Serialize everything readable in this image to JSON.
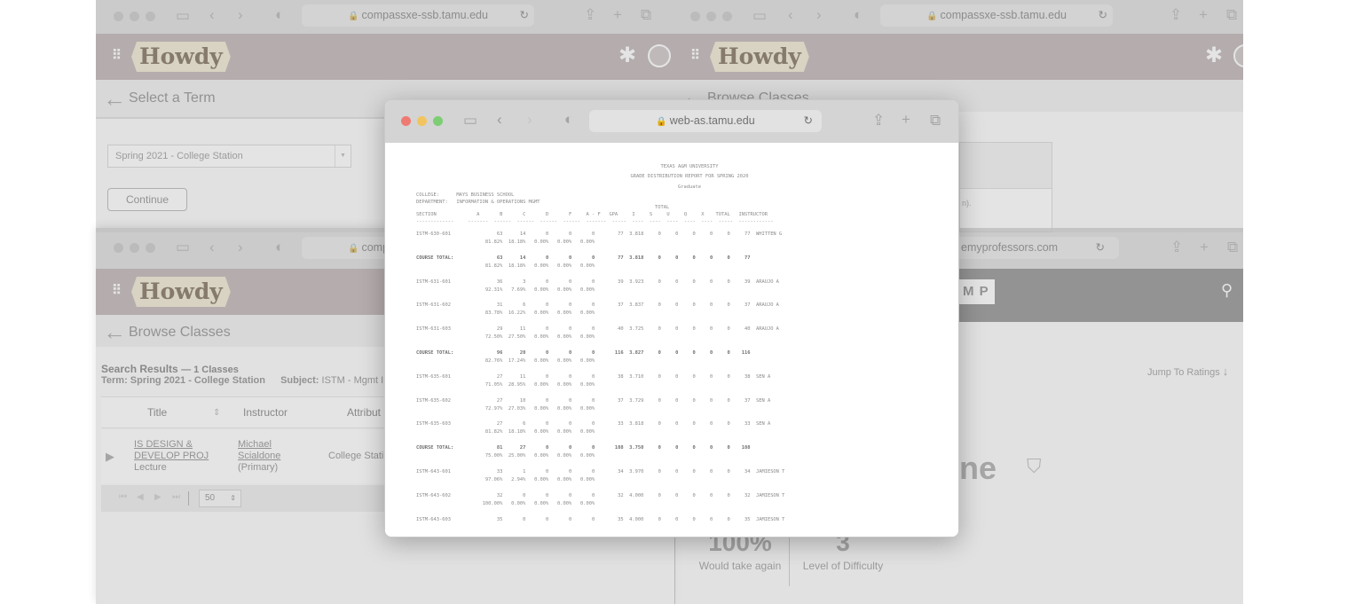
{
  "win_top_left": {
    "url": "compassxe-ssb.tamu.edu",
    "logo": "Howdy",
    "page_title": "Select a Term",
    "term_value": "Spring 2021 - College Station",
    "continue_label": "Continue"
  },
  "win_top_right": {
    "url": "compassxe-ssb.tamu.edu",
    "logo": "Howdy",
    "page_title": "Browse Classes",
    "snippet": "n)."
  },
  "win_browse": {
    "url": "comp",
    "logo": "Howdy",
    "page_title": "Browse Classes",
    "results_title": "Search Results",
    "results_count": "— 1 Classes",
    "term_line": "Term: Spring 2021 - College Station",
    "subject_label": "Subject:",
    "subject_value": "ISTM - Mgmt I",
    "columns": [
      "Title",
      "Instructor",
      "Attribut"
    ],
    "row": {
      "title_1": "IS DESIGN &",
      "title_2": "DEVELOP PROJ",
      "type": "Lecture",
      "instructor_1": "Michael",
      "instructor_2": "Scialdone",
      "instructor_role": "(Primary)",
      "attribute": "College Stati"
    },
    "page_size": "50"
  },
  "win_rmp": {
    "url": "emyprofessors.com",
    "logo": "M P",
    "jump_label": "Jump To Ratings",
    "name_fragment": "ne",
    "stat1_value": "100%",
    "stat1_label": "Would take again",
    "stat2_value": "3",
    "stat2_label": "Level of Difficulty"
  },
  "win_grade": {
    "url": "web-as.tamu.edu",
    "title1": "TEXAS A&M UNIVERSITY",
    "title2": "GRADE DISTRIBUTION REPORT FOR SPRING 2020",
    "title3": "Graduate",
    "college_line": "COLLEGE:      MAYS BUSINESS SCHOOL",
    "dept_line": "DEPARTMENT:   INFORMATION & OPERATIONS MGMT",
    "total_label": "TOTAL",
    "header": "SECTION              A       B       C       D       F     A - F   GPA     I     S     U     Q     X    TOTAL   INSTRUCTOR",
    "dashes": "-------------     -------  ------  ------  ------  ------  -------  -----  ----  ----  ----  ----  ----  -----  ------------",
    "rows": [
      {
        "a": "ISTM-630-601                63      14       0       0       0        77  3.818     0     0     0     0     0     77  WHITTEN G",
        "b": "                        81.82%  18.18%   0.00%   0.00%   0.00%",
        "bold": false
      },
      {
        "a": "COURSE TOTAL:               63      14       0       0       0        77  3.818     0     0     0     0     0     77",
        "b": "                        81.82%  18.18%   0.00%   0.00%   0.00%",
        "bold": true
      },
      {
        "a": "ISTM-631-601                36       3       0       0       0        39  3.923     0     0     0     0     0     39  ARAUJO A",
        "b": "                        92.31%   7.69%   0.00%   0.00%   0.00%",
        "bold": false
      },
      {
        "a": "ISTM-631-602                31       6       0       0       0        37  3.837     0     0     0     0     0     37  ARAUJO A",
        "b": "                        83.78%  16.22%   0.00%   0.00%   0.00%",
        "bold": false
      },
      {
        "a": "ISTM-631-603                29      11       0       0       0        40  3.725     0     0     0     0     0     40  ARAUJO A",
        "b": "                        72.50%  27.50%   0.00%   0.00%   0.00%",
        "bold": false
      },
      {
        "a": "COURSE TOTAL:               96      20       0       0       0       116  3.827     0     0     0     0     0    116",
        "b": "                        82.76%  17.24%   0.00%   0.00%   0.00%",
        "bold": true
      },
      {
        "a": "ISTM-635-601                27      11       0       0       0        38  3.710     0     0     0     0     0     38  SEN A",
        "b": "                        71.05%  28.95%   0.00%   0.00%   0.00%",
        "bold": false
      },
      {
        "a": "ISTM-635-602                27      10       0       0       0        37  3.729     0     0     0     0     0     37  SEN A",
        "b": "                        72.97%  27.03%   0.00%   0.00%   0.00%",
        "bold": false
      },
      {
        "a": "ISTM-635-603                27       6       0       0       0        33  3.818     0     0     0     0     0     33  SEN A",
        "b": "                        81.82%  18.18%   0.00%   0.00%   0.00%",
        "bold": false
      },
      {
        "a": "COURSE TOTAL:               81      27       0       0       0       108  3.750     0     0     0     0     0    108",
        "b": "                        75.00%  25.00%   0.00%   0.00%   0.00%",
        "bold": true
      },
      {
        "a": "ISTM-643-601                33       1       0       0       0        34  3.970     0     0     0     0     0     34  JAMIESON T",
        "b": "                        97.06%   2.94%   0.00%   0.00%   0.00%",
        "bold": false
      },
      {
        "a": "ISTM-643-602                32       0       0       0       0        32  4.000     0     0     0     0     0     32  JAMIESON T",
        "b": "                       100.00%   0.00%   0.00%   0.00%   0.00%",
        "bold": false
      },
      {
        "a": "ISTM-643-603                35       0       0       0       0        35  4.000     0     0     0     0     0     35  JAMIESON T",
        "b": "",
        "bold": false
      }
    ]
  }
}
